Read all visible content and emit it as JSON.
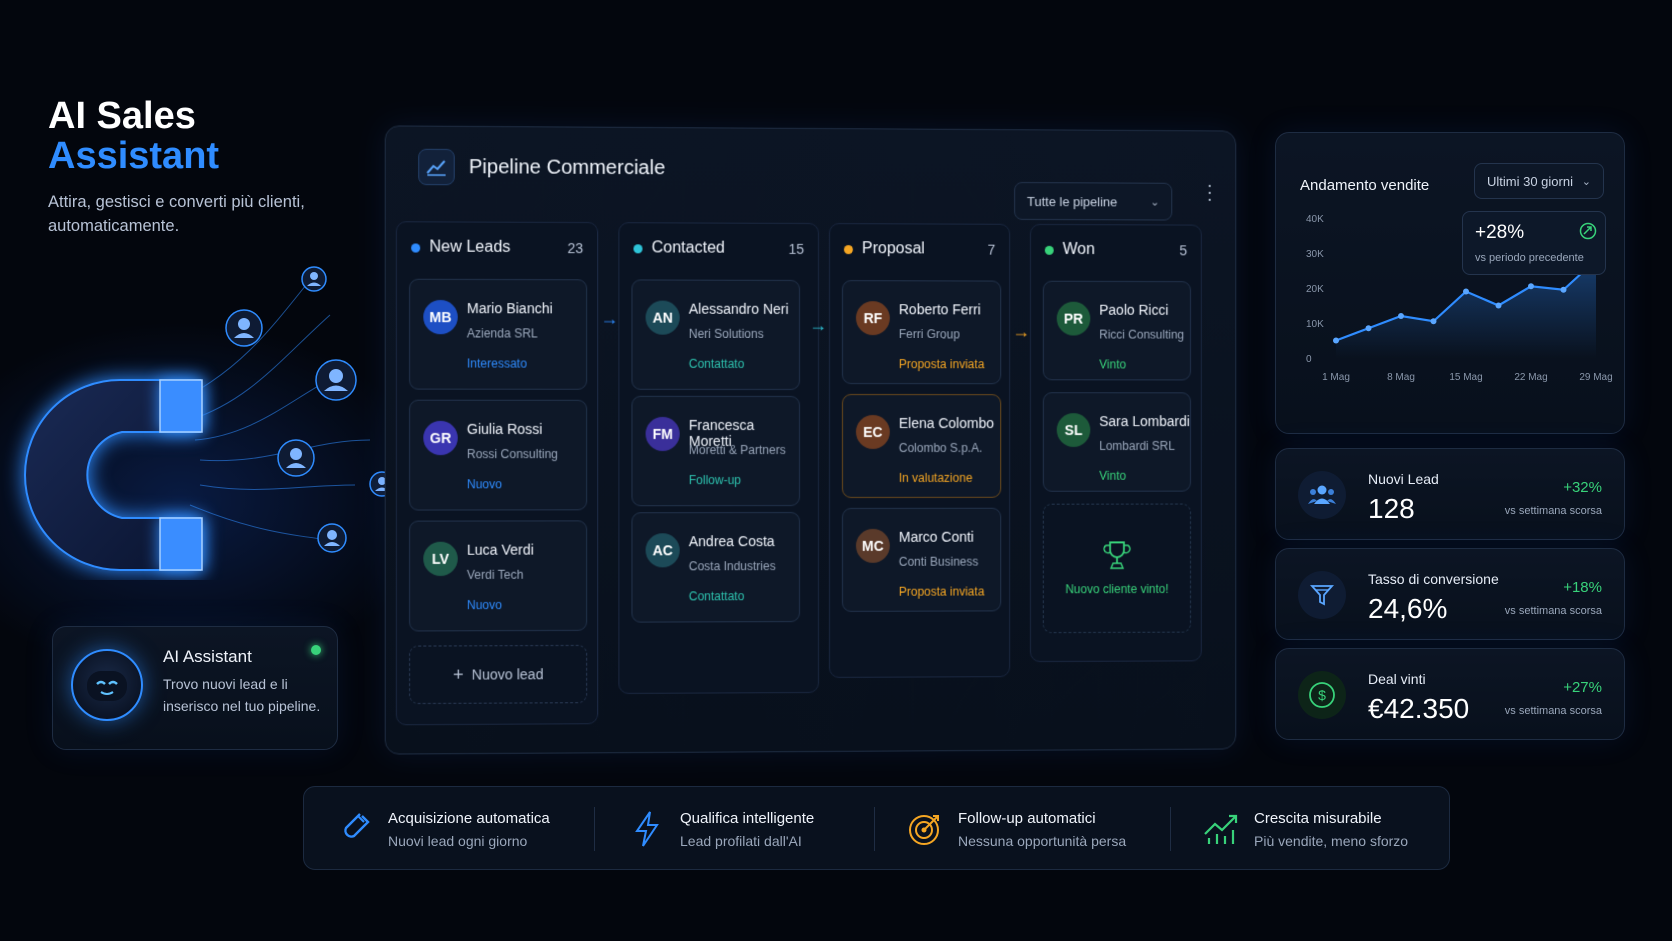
{
  "hero": {
    "title_line1": "AI Sales",
    "title_line2": "Assistant",
    "subtitle": "Attira, gestisci e converti più clienti, automaticamente."
  },
  "pipeline": {
    "title": "Pipeline Commerciale",
    "filter": "Tutte le pipeline",
    "columns": [
      {
        "name": "New Leads",
        "count": "23",
        "color": "#2f8cff",
        "cards": [
          {
            "initials": "MB",
            "name": "Mario Bianchi",
            "company": "Azienda SRL",
            "status": "Interessato",
            "status_color": "#2f8cff",
            "avatar_color": "#1d4fc4"
          },
          {
            "initials": "GR",
            "name": "Giulia Rossi",
            "company": "Rossi Consulting",
            "status": "Nuovo",
            "status_color": "#2f8cff",
            "avatar_color": "#3a35b0"
          },
          {
            "initials": "LV",
            "name": "Luca Verdi",
            "company": "Verdi Tech",
            "status": "Nuovo",
            "status_color": "#2f8cff",
            "avatar_color": "#1f5a4a"
          }
        ],
        "add_label": "Nuovo lead"
      },
      {
        "name": "Contacted",
        "count": "15",
        "color": "#2ec4d8",
        "cards": [
          {
            "initials": "AN",
            "name": "Alessandro Neri",
            "company": "Neri Solutions",
            "status": "Contattato",
            "status_color": "#2ec4b0",
            "avatar_color": "#1c4a58"
          },
          {
            "initials": "FM",
            "name": "Francesca Moretti",
            "company": "Moretti & Partners",
            "status": "Follow-up",
            "status_color": "#2ec4b0",
            "avatar_color": "#3a2f9a"
          },
          {
            "initials": "AC",
            "name": "Andrea Costa",
            "company": "Costa Industries",
            "status": "Contattato",
            "status_color": "#2ec4b0",
            "avatar_color": "#1c4a58"
          }
        ]
      },
      {
        "name": "Proposal",
        "count": "7",
        "color": "#f5a623",
        "cards": [
          {
            "initials": "RF",
            "name": "Roberto Ferri",
            "company": "Ferri Group",
            "status": "Proposta inviata",
            "status_color": "#f5a623",
            "avatar_color": "#6a3a22"
          },
          {
            "initials": "EC",
            "name": "Elena Colombo",
            "company": "Colombo S.p.A.",
            "status": "In valutazione",
            "status_color": "#f5a623",
            "avatar_color": "#6a3a22"
          },
          {
            "initials": "MC",
            "name": "Marco Conti",
            "company": "Conti Business",
            "status": "Proposta inviata",
            "status_color": "#f5a623",
            "avatar_color": "#5a3a2a"
          }
        ]
      },
      {
        "name": "Won",
        "count": "5",
        "color": "#38d27a",
        "cards": [
          {
            "initials": "PR",
            "name": "Paolo Ricci",
            "company": "Ricci Consulting",
            "status": "Vinto",
            "status_color": "#38d27a",
            "avatar_color": "#1d5a3a"
          },
          {
            "initials": "SL",
            "name": "Sara Lombardi",
            "company": "Lombardi SRL",
            "status": "Vinto",
            "status_color": "#38d27a",
            "avatar_color": "#1d5a3a"
          }
        ],
        "won_label": "Nuovo cliente vinto!"
      }
    ]
  },
  "assistant": {
    "title": "AI Assistant",
    "text": "Trovo nuovi lead e li inserisco nel tuo pipeline."
  },
  "sales_chart": {
    "title": "Andamento vendite",
    "period": "Ultimi 30 giorni",
    "badge_value": "+28%",
    "badge_text": "vs periodo precedente"
  },
  "chart_data": {
    "type": "line",
    "title": "Andamento vendite",
    "x": [
      "1 Mag",
      "4 Mag",
      "8 Mag",
      "11 Mag",
      "15 Mag",
      "18 Mag",
      "22 Mag",
      "25 Mag",
      "29 Mag"
    ],
    "x_ticks": [
      "1 Mag",
      "8 Mag",
      "15 Mag",
      "22 Mag",
      "29 Mag"
    ],
    "y_ticks": [
      "0",
      "10K",
      "20K",
      "30K",
      "40K"
    ],
    "values": [
      5000,
      8500,
      12000,
      10500,
      19000,
      15000,
      20500,
      19500,
      28000
    ],
    "ylim": [
      0,
      40000
    ],
    "grid": false
  },
  "kpis": [
    {
      "label": "Nuovi Lead",
      "value": "128",
      "delta": "+32%",
      "compare": "vs settimana scorsa",
      "icon": "users-icon"
    },
    {
      "label": "Tasso di conversione",
      "value": "24,6%",
      "delta": "+18%",
      "compare": "vs settimana scorsa",
      "icon": "funnel-icon"
    },
    {
      "label": "Deal vinti",
      "value": "€42.350",
      "delta": "+27%",
      "compare": "vs settimana scorsa",
      "icon": "dollar-icon"
    }
  ],
  "features": [
    {
      "title": "Acquisizione automatica",
      "subtitle": "Nuovi lead ogni giorno",
      "icon": "magnet-icon",
      "color": "#2f8cff"
    },
    {
      "title": "Qualifica intelligente",
      "subtitle": "Lead profilati dall'AI",
      "icon": "lightning-icon",
      "color": "#2f8cff"
    },
    {
      "title": "Follow-up automatici",
      "subtitle": "Nessuna opportunità persa",
      "icon": "target-icon",
      "color": "#f5a623"
    },
    {
      "title": "Crescita misurabile",
      "subtitle": "Più vendite, meno sforzo",
      "icon": "growth-icon",
      "color": "#38d27a"
    }
  ]
}
